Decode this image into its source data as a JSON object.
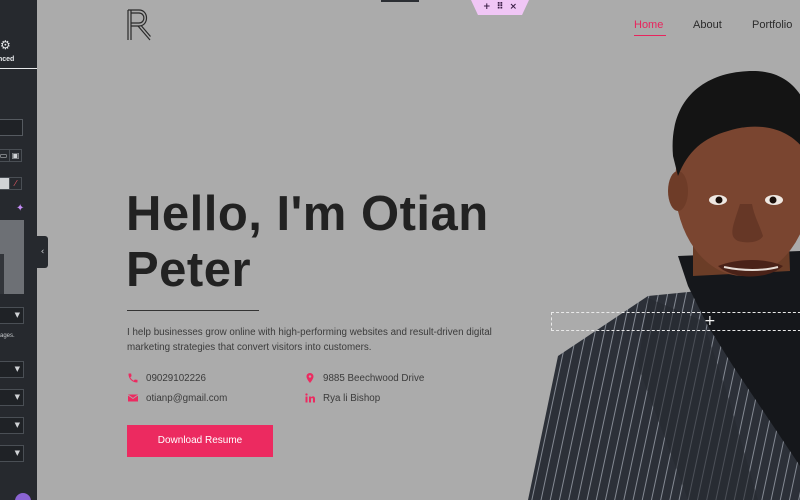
{
  "editor": {
    "gear_icon": "⚙",
    "advanced_label": "nced",
    "ages_text": "ages.",
    "dropdown_icon": "▼",
    "spark_icon": "✦",
    "collapse_icon": "‹",
    "section_handle": {
      "add": "+",
      "drag": "⠿",
      "close": "×"
    },
    "drop_plus": "+"
  },
  "header": {
    "nav": [
      {
        "label": "Home",
        "active": true
      },
      {
        "label": "About",
        "active": false
      },
      {
        "label": "Portfolio",
        "active": false
      }
    ]
  },
  "hero": {
    "title_line1": "Hello, I'm Otian",
    "title_line2": "Peter",
    "description": "I help businesses grow online with high-performing websites and result-driven digital marketing strategies that convert visitors into customers.",
    "contacts": [
      {
        "icon": "phone-icon",
        "text": "09029102226"
      },
      {
        "icon": "location-icon",
        "text": "9885 Beechwood Drive"
      },
      {
        "icon": "email-icon",
        "text": "otianp@gmail.com"
      },
      {
        "icon": "linkedin-icon",
        "text": "Rya li Bishop"
      }
    ],
    "cta_label": "Download Resume"
  },
  "colors": {
    "accent": "#ec2a60",
    "page_bg": "#ababab",
    "panel_bg": "#26292e",
    "heading": "#222222"
  }
}
